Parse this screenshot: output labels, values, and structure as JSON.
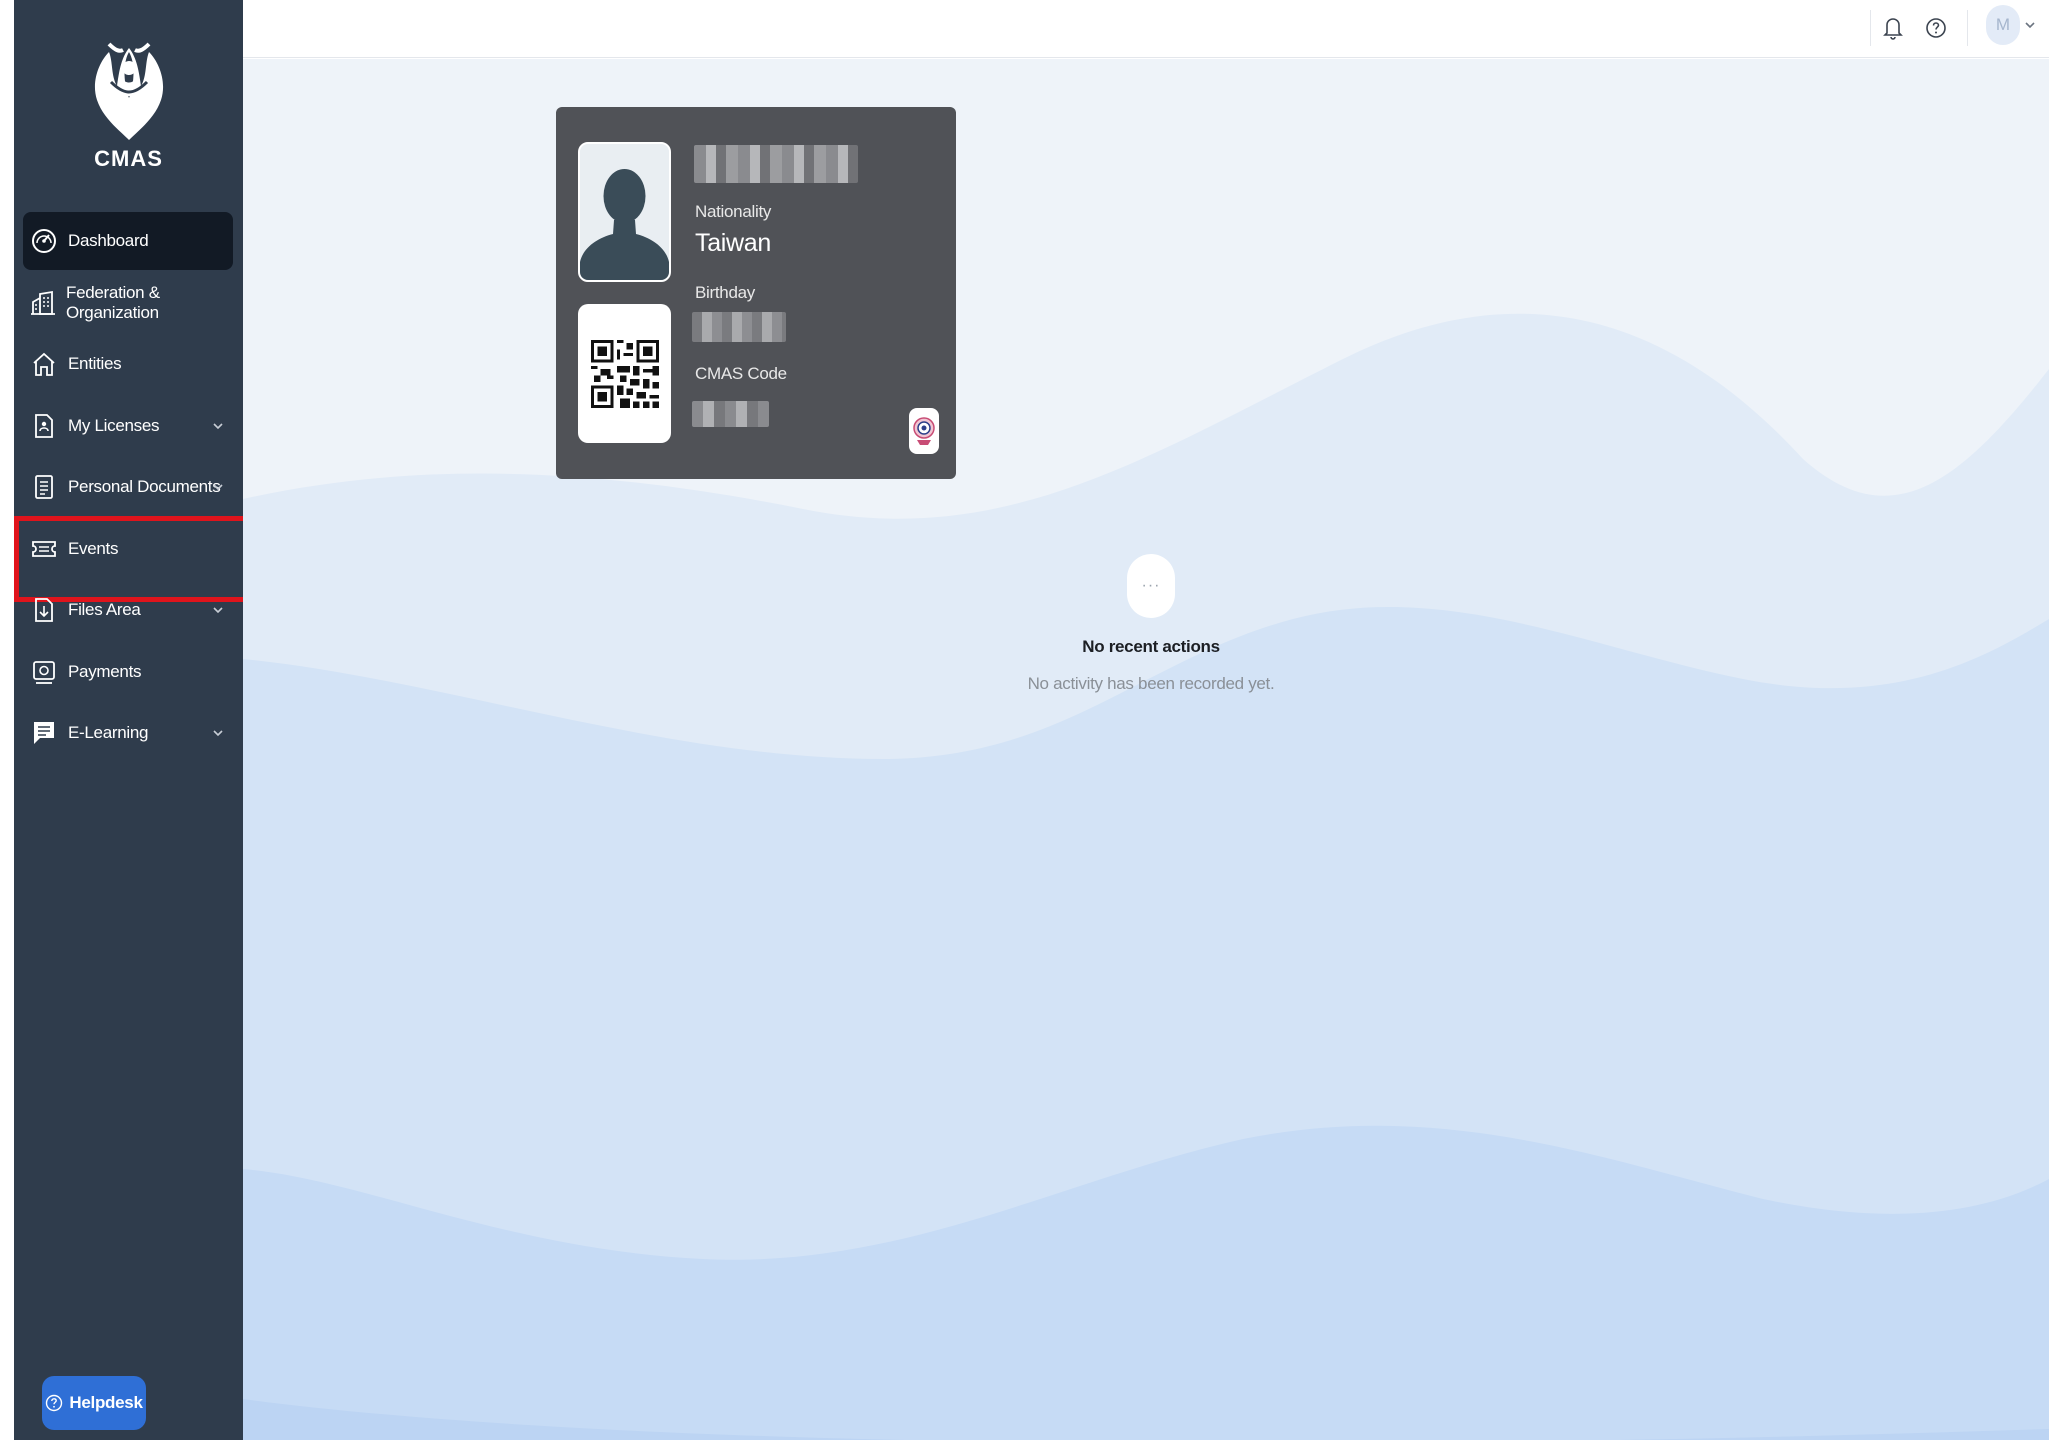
{
  "app": {
    "logo_text": "CMAS"
  },
  "sidebar": {
    "items": [
      {
        "label": "Dashboard",
        "icon": "speedometer-icon",
        "active": true,
        "has_submenu": false
      },
      {
        "label": "Federation & Organization",
        "icon": "building-icon",
        "active": false,
        "has_submenu": false
      },
      {
        "label": "Entities",
        "icon": "home-icon",
        "active": false,
        "has_submenu": false
      },
      {
        "label": "My Licenses",
        "icon": "license-icon",
        "active": false,
        "has_submenu": true
      },
      {
        "label": "Personal Documents",
        "icon": "document-icon",
        "active": false,
        "has_submenu": true
      },
      {
        "label": "Events",
        "icon": "ticket-icon",
        "active": false,
        "has_submenu": false,
        "highlighted": true
      },
      {
        "label": "Files Area",
        "icon": "file-download-icon",
        "active": false,
        "has_submenu": true
      },
      {
        "label": "Payments",
        "icon": "payment-icon",
        "active": false,
        "has_submenu": false
      },
      {
        "label": "E-Learning",
        "icon": "chat-lines-icon",
        "active": false,
        "has_submenu": true
      }
    ],
    "helpdesk_label": "Helpdesk"
  },
  "topbar": {
    "notification_icon": "bell-icon",
    "help_icon": "question-circle-icon",
    "user_initial": "M"
  },
  "id_card": {
    "nationality_label": "Nationality",
    "nationality_value": "Taiwan",
    "birthday_label": "Birthday",
    "cmas_code_label": "CMAS Code"
  },
  "activity": {
    "icon_text": "···",
    "title": "No recent actions",
    "subtitle": "No activity has been recorded yet."
  },
  "colors": {
    "sidebar_bg": "#2f3c4c",
    "sidebar_active": "#121a25",
    "highlight_border": "#e0141c",
    "card_bg": "#505257",
    "helpdesk_bg": "#2f6fd6",
    "main_bg": "#eef3f9"
  }
}
